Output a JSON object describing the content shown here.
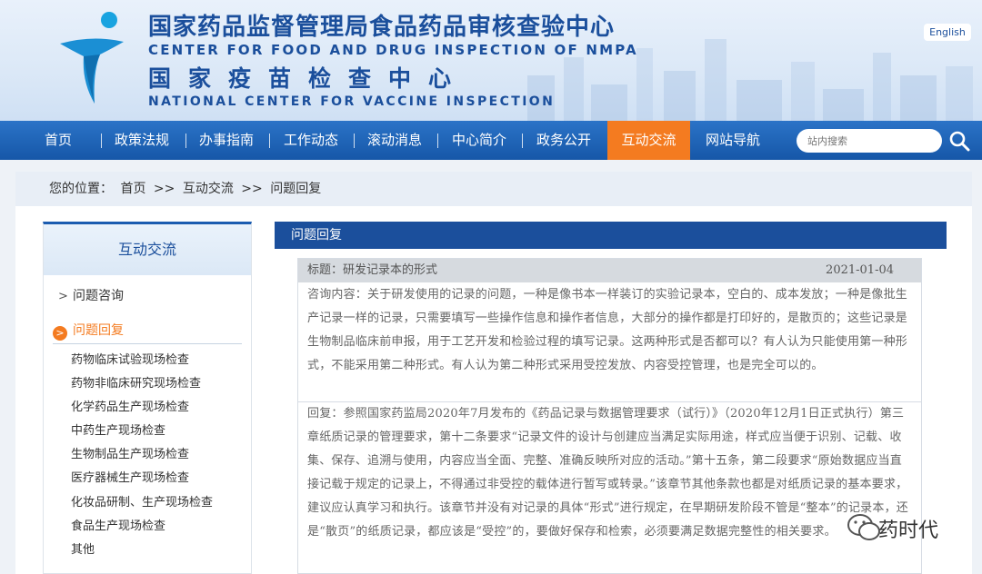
{
  "header": {
    "title_cn": "国家药品监督管理局食品药品审核查验中心",
    "title_en": "CENTER FOR FOOD AND DRUG INSPECTION OF NMPA",
    "subtitle_cn": "国家疫苗检查中心",
    "subtitle_en": "NATIONAL CENTER FOR VACCINE INSPECTION",
    "lang_button": "English"
  },
  "nav": {
    "items": [
      "首页",
      "政策法规",
      "办事指南",
      "工作动态",
      "滚动消息",
      "中心简介",
      "政务公开",
      "互动交流",
      "网站导航"
    ],
    "active_index": 7,
    "search_placeholder": "站内搜索"
  },
  "breadcrumb": {
    "prefix": "您的位置：",
    "items": [
      "首页",
      "互动交流",
      "问题回复"
    ],
    "separator": ">>"
  },
  "sidebar": {
    "title": "互动交流",
    "items": [
      {
        "label": "问题咨询",
        "active": false
      },
      {
        "label": "问题回复",
        "active": true
      }
    ],
    "sub_items": [
      "药物临床试验现场检查",
      "药物非临床研究现场检查",
      "化学药品生产现场检查",
      "中药生产现场检查",
      "生物制品生产现场检查",
      "医疗器械生产现场检查",
      "化妆品研制、生产现场检查",
      "食品生产现场检查",
      "其他"
    ]
  },
  "content": {
    "header": "问题回复",
    "title": "标题：研发记录本的形式",
    "date": "2021-01-04",
    "question": "咨询内容：关于研发使用的记录的问题，一种是像书本一样装订的实验记录本，空白的、成本发放；一种是像批生产记录一样的记录，只需要填写一些操作信息和操作者信息，大部分的操作都是打印好的，是散页的；这些记录是生物制品临床前申报，用于工艺开发和检验过程的填写记录。这两种形式是否都可以？有人认为只能使用第一种形式，不能采用第二种形式。有人认为第二种形式采用受控发放、内容受控管理，也是完全可以的。",
    "answer": "回复：参照国家药监局2020年7月发布的《药品记录与数据管理要求（试行）》（2020年12月1日正式执行）第三章纸质记录的管理要求，第十二条要求“记录文件的设计与创建应当满足实际用途，样式应当便于识别、记载、收集、保存、追溯与使用，内容应当全面、完整、准确反映所对应的活动。”第十五条，第二段要求“原始数据应当直接记载于规定的记录上，不得通过非受控的载体进行暂写或转录。”该章节其他条款也都是对纸质记录的基本要求，建议应认真学习和执行。该章节并没有对记录的具体“形式”进行规定，在早期研发阶段不管是“整本”的记录本，还是“散页”的纸质记录，都应该是“受控”的，要做好保存和检索，必须要满足数据完整性的相关要求。"
  },
  "watermark": {
    "text": "药时代"
  },
  "colors": {
    "nav_blue": "#1657a8",
    "active_orange": "#f47b20",
    "brand_blue": "#1b4f9c"
  }
}
